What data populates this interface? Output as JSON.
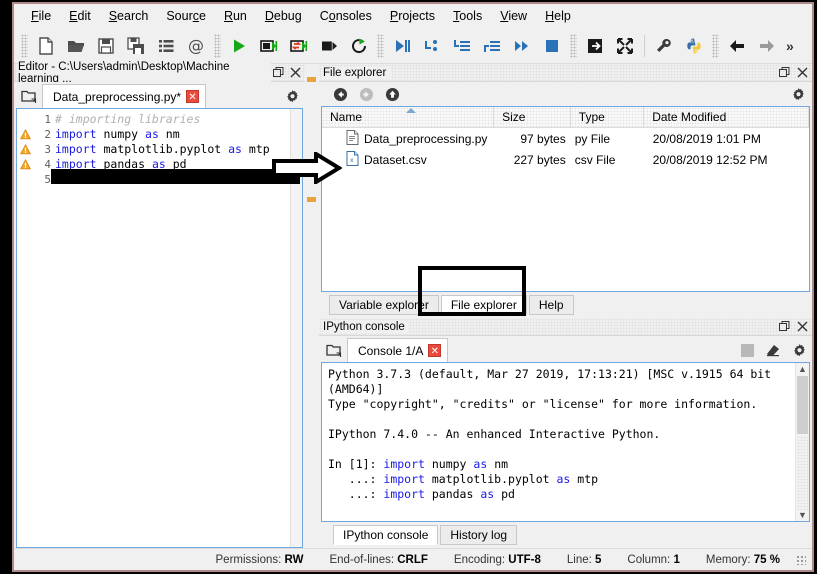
{
  "window": {
    "frame_color": "#b08a8a"
  },
  "menubar": {
    "items": [
      {
        "label": "File",
        "accel": "F"
      },
      {
        "label": "Edit",
        "accel": "E"
      },
      {
        "label": "Search",
        "accel": "S"
      },
      {
        "label": "Source",
        "accel": "c"
      },
      {
        "label": "Run",
        "accel": "R"
      },
      {
        "label": "Debug",
        "accel": "D"
      },
      {
        "label": "Consoles",
        "accel": "o"
      },
      {
        "label": "Projects",
        "accel": "P"
      },
      {
        "label": "Tools",
        "accel": "T"
      },
      {
        "label": "View",
        "accel": "V"
      },
      {
        "label": "Help",
        "accel": "H"
      }
    ]
  },
  "toolbar": {
    "more_label": "»",
    "buttons": [
      {
        "name": "new-file-icon",
        "title": "New file"
      },
      {
        "name": "open-file-icon",
        "title": "Open file"
      },
      {
        "name": "save-file-icon",
        "title": "Save file"
      },
      {
        "name": "save-all-icon",
        "title": "Save all"
      },
      {
        "name": "run-file-icon",
        "title": "Run file"
      },
      {
        "name": "run-cell-icon",
        "title": "Run current cell"
      },
      {
        "name": "run-cell-advance-icon",
        "title": "Run cell and advance"
      },
      {
        "name": "run-selection-icon",
        "title": "Run selection"
      },
      {
        "name": "rerun-icon",
        "title": "Re-run last cell"
      },
      {
        "name": "debug-file-icon",
        "title": "Debug file"
      },
      {
        "name": "debug-step-over-icon",
        "title": "Step over"
      },
      {
        "name": "debug-step-into-icon",
        "title": "Step into"
      },
      {
        "name": "debug-step-return-icon",
        "title": "Step return"
      },
      {
        "name": "debug-continue-icon",
        "title": "Continue"
      },
      {
        "name": "debug-stop-icon",
        "title": "Stop debugging"
      },
      {
        "name": "maximize-pane-icon",
        "title": "Maximize current pane"
      },
      {
        "name": "fullscreen-icon",
        "title": "Fullscreen mode"
      },
      {
        "name": "preferences-icon",
        "title": "Preferences"
      },
      {
        "name": "pythonpath-icon",
        "title": "PYTHONPATH manager"
      },
      {
        "name": "back-icon",
        "title": "Go back"
      },
      {
        "name": "forward-icon",
        "title": "Go forward"
      }
    ]
  },
  "editor": {
    "pane_title": "Editor - C:\\Users\\admin\\Desktop\\Machine learning ...",
    "tab": {
      "label": "Data_preprocessing.py*",
      "close_glyph": "✕"
    },
    "lines": [
      {
        "no": "1",
        "warn": false,
        "tokens": [
          {
            "t": "# importing libraries",
            "c": "cm"
          }
        ]
      },
      {
        "no": "2",
        "warn": true,
        "tokens": [
          {
            "t": "import",
            "c": "kw"
          },
          {
            "t": " numpy ",
            "c": ""
          },
          {
            "t": "as",
            "c": "kw"
          },
          {
            "t": " nm",
            "c": ""
          }
        ]
      },
      {
        "no": "3",
        "warn": true,
        "tokens": [
          {
            "t": "import",
            "c": "kw"
          },
          {
            "t": " matplotlib.pyplot ",
            "c": ""
          },
          {
            "t": "as",
            "c": "kw"
          },
          {
            "t": " mtp",
            "c": ""
          }
        ]
      },
      {
        "no": "4",
        "warn": true,
        "tokens": [
          {
            "t": "import",
            "c": "kw"
          },
          {
            "t": " pandas ",
            "c": ""
          },
          {
            "t": "as",
            "c": "kw"
          },
          {
            "t": " pd",
            "c": ""
          }
        ]
      },
      {
        "no": "5",
        "warn": false,
        "tokens": []
      }
    ],
    "redaction_on_line": "5"
  },
  "file_explorer": {
    "pane_title": "File explorer",
    "nav": [
      {
        "name": "back-icon",
        "label": "Back",
        "enabled": true
      },
      {
        "name": "forward-icon",
        "label": "Forward",
        "enabled": false
      },
      {
        "name": "parent-dir-icon",
        "label": "Parent directory",
        "enabled": true
      }
    ],
    "columns": [
      "Name",
      "Size",
      "Type",
      "Date Modified"
    ],
    "sort_column": "Name",
    "rows": [
      {
        "icon": "py-file-icon",
        "name": "Data_preprocessing.py",
        "size": "97 bytes",
        "type": "py File",
        "modified": "20/08/2019 1:01 PM"
      },
      {
        "icon": "csv-file-icon",
        "name": "Dataset.csv",
        "size": "227 bytes",
        "type": "csv File",
        "modified": "20/08/2019 12:52 PM"
      }
    ],
    "tabs": [
      {
        "label": "Variable explorer",
        "active": false
      },
      {
        "label": "File explorer",
        "active": true
      },
      {
        "label": "Help",
        "active": false
      }
    ],
    "highlighted_tab": "File explorer"
  },
  "console": {
    "pane_title": "IPython console",
    "tab": {
      "label": "Console 1/A",
      "close_glyph": "✕"
    },
    "lines": [
      [
        {
          "t": "Python 3.7.3 (default, Mar 27 2019, 17:13:21) [MSC v.1915 64 bit",
          "c": ""
        }
      ],
      [
        {
          "t": "(AMD64)]",
          "c": ""
        }
      ],
      [
        {
          "t": "Type \"copyright\", \"credits\" or \"license\" for more information.",
          "c": ""
        }
      ],
      [
        {
          "t": "",
          "c": ""
        }
      ],
      [
        {
          "t": "IPython 7.4.0 -- An enhanced Interactive Python.",
          "c": ""
        }
      ],
      [
        {
          "t": "",
          "c": ""
        }
      ],
      [
        {
          "t": "In [1]: ",
          "c": ""
        },
        {
          "t": "import",
          "c": "kw"
        },
        {
          "t": " numpy ",
          "c": ""
        },
        {
          "t": "as",
          "c": "kw"
        },
        {
          "t": " nm",
          "c": ""
        }
      ],
      [
        {
          "t": "   ...: ",
          "c": ""
        },
        {
          "t": "import",
          "c": "kw"
        },
        {
          "t": " matplotlib.pyplot ",
          "c": ""
        },
        {
          "t": "as",
          "c": "kw"
        },
        {
          "t": " mtp",
          "c": ""
        }
      ],
      [
        {
          "t": "   ...: ",
          "c": ""
        },
        {
          "t": "import",
          "c": "kw"
        },
        {
          "t": " pandas ",
          "c": ""
        },
        {
          "t": "as",
          "c": "kw"
        },
        {
          "t": " pd",
          "c": ""
        }
      ]
    ],
    "tabs": [
      {
        "label": "IPython console",
        "active": true
      },
      {
        "label": "History log",
        "active": false
      }
    ],
    "toolbar_buttons": [
      {
        "name": "console-options-icon",
        "label": "Options"
      },
      {
        "name": "clear-console-icon",
        "label": "Remove all variables"
      },
      {
        "name": "gear-icon",
        "label": "Options"
      }
    ]
  },
  "statusbar": {
    "items": [
      {
        "label": "Permissions:",
        "value": "RW"
      },
      {
        "label": "End-of-lines:",
        "value": "CRLF"
      },
      {
        "label": "Encoding:",
        "value": "UTF-8"
      },
      {
        "label": "Line:",
        "value": "5"
      },
      {
        "label": "Column:",
        "value": "1"
      },
      {
        "label": "Memory:",
        "value": "75 %"
      }
    ]
  }
}
